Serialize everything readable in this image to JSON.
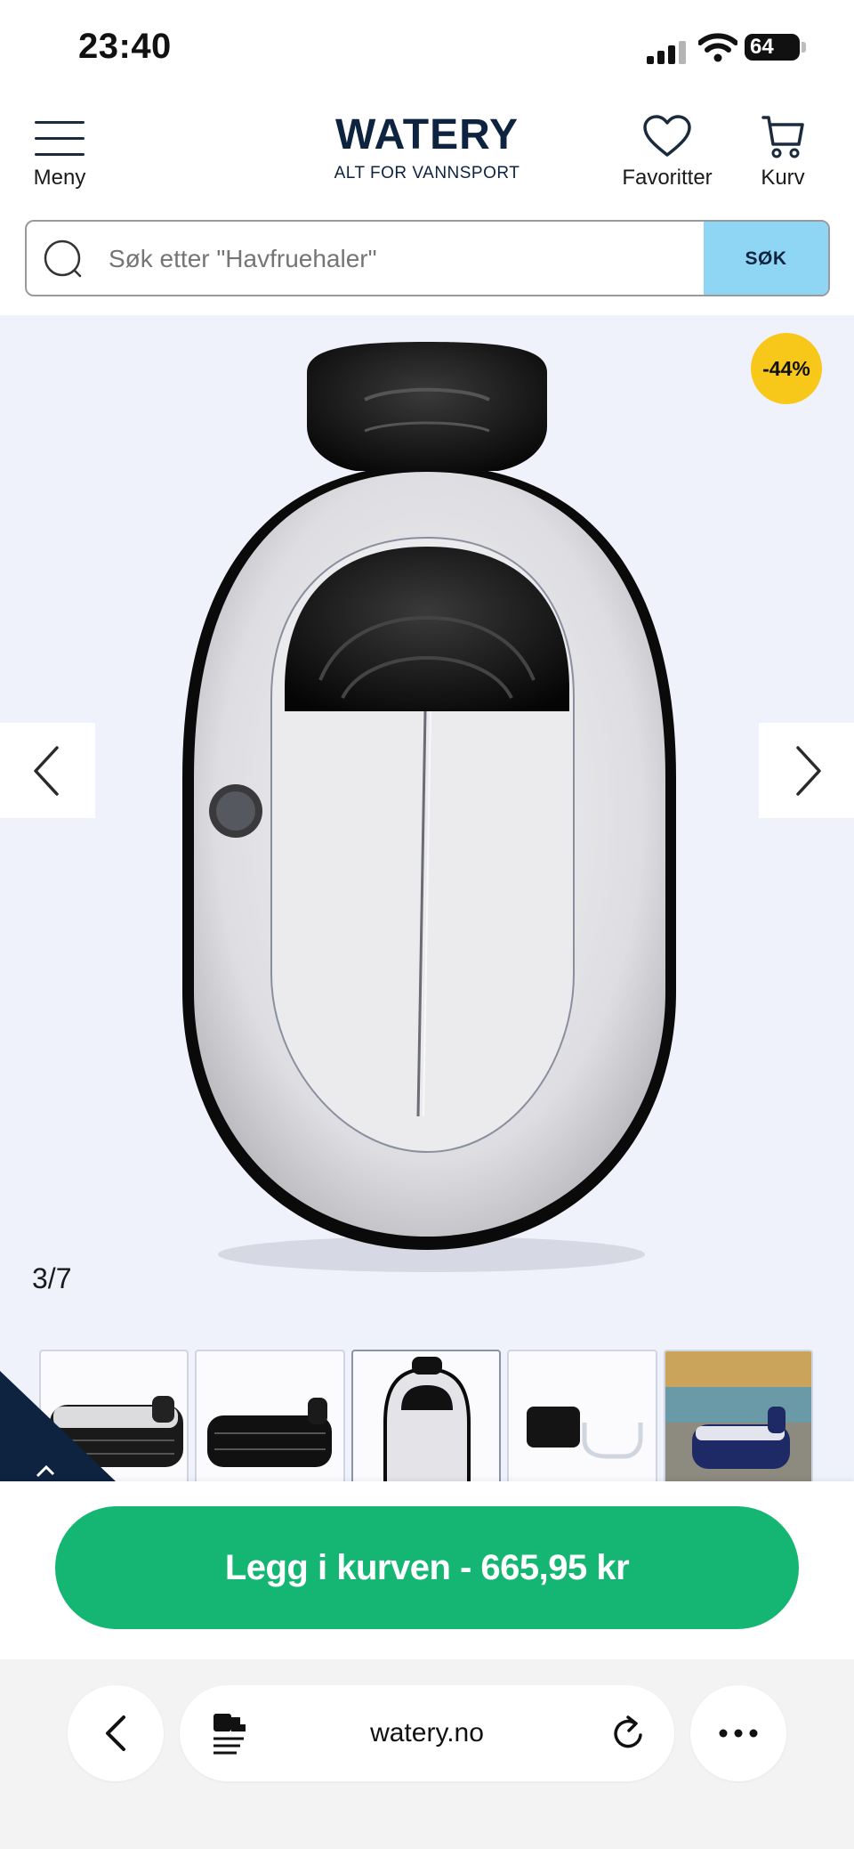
{
  "status_bar": {
    "time": "23:40",
    "battery": "64"
  },
  "header": {
    "menu_label": "Meny",
    "logo_title": "WATERY",
    "logo_subtitle": "ALT FOR VANNSPORT",
    "favorites_label": "Favoritter",
    "cart_label": "Kurv"
  },
  "search": {
    "placeholder": "Søk etter \"Havfruehaler\"",
    "button_label": "SØK"
  },
  "gallery": {
    "discount_badge": "-44%",
    "counter": "3/7",
    "thumbnail_count": 5,
    "active_thumbnail": 3
  },
  "cart_button": {
    "label": "Legg i kurven - 665,95 kr"
  },
  "browser": {
    "url": "watery.no"
  },
  "colors": {
    "brand_navy": "#0d2340",
    "accent_green": "#15b673",
    "badge_yellow": "#f7c819",
    "search_button": "#8fd6f4",
    "gallery_bg": "#eff2fa"
  }
}
